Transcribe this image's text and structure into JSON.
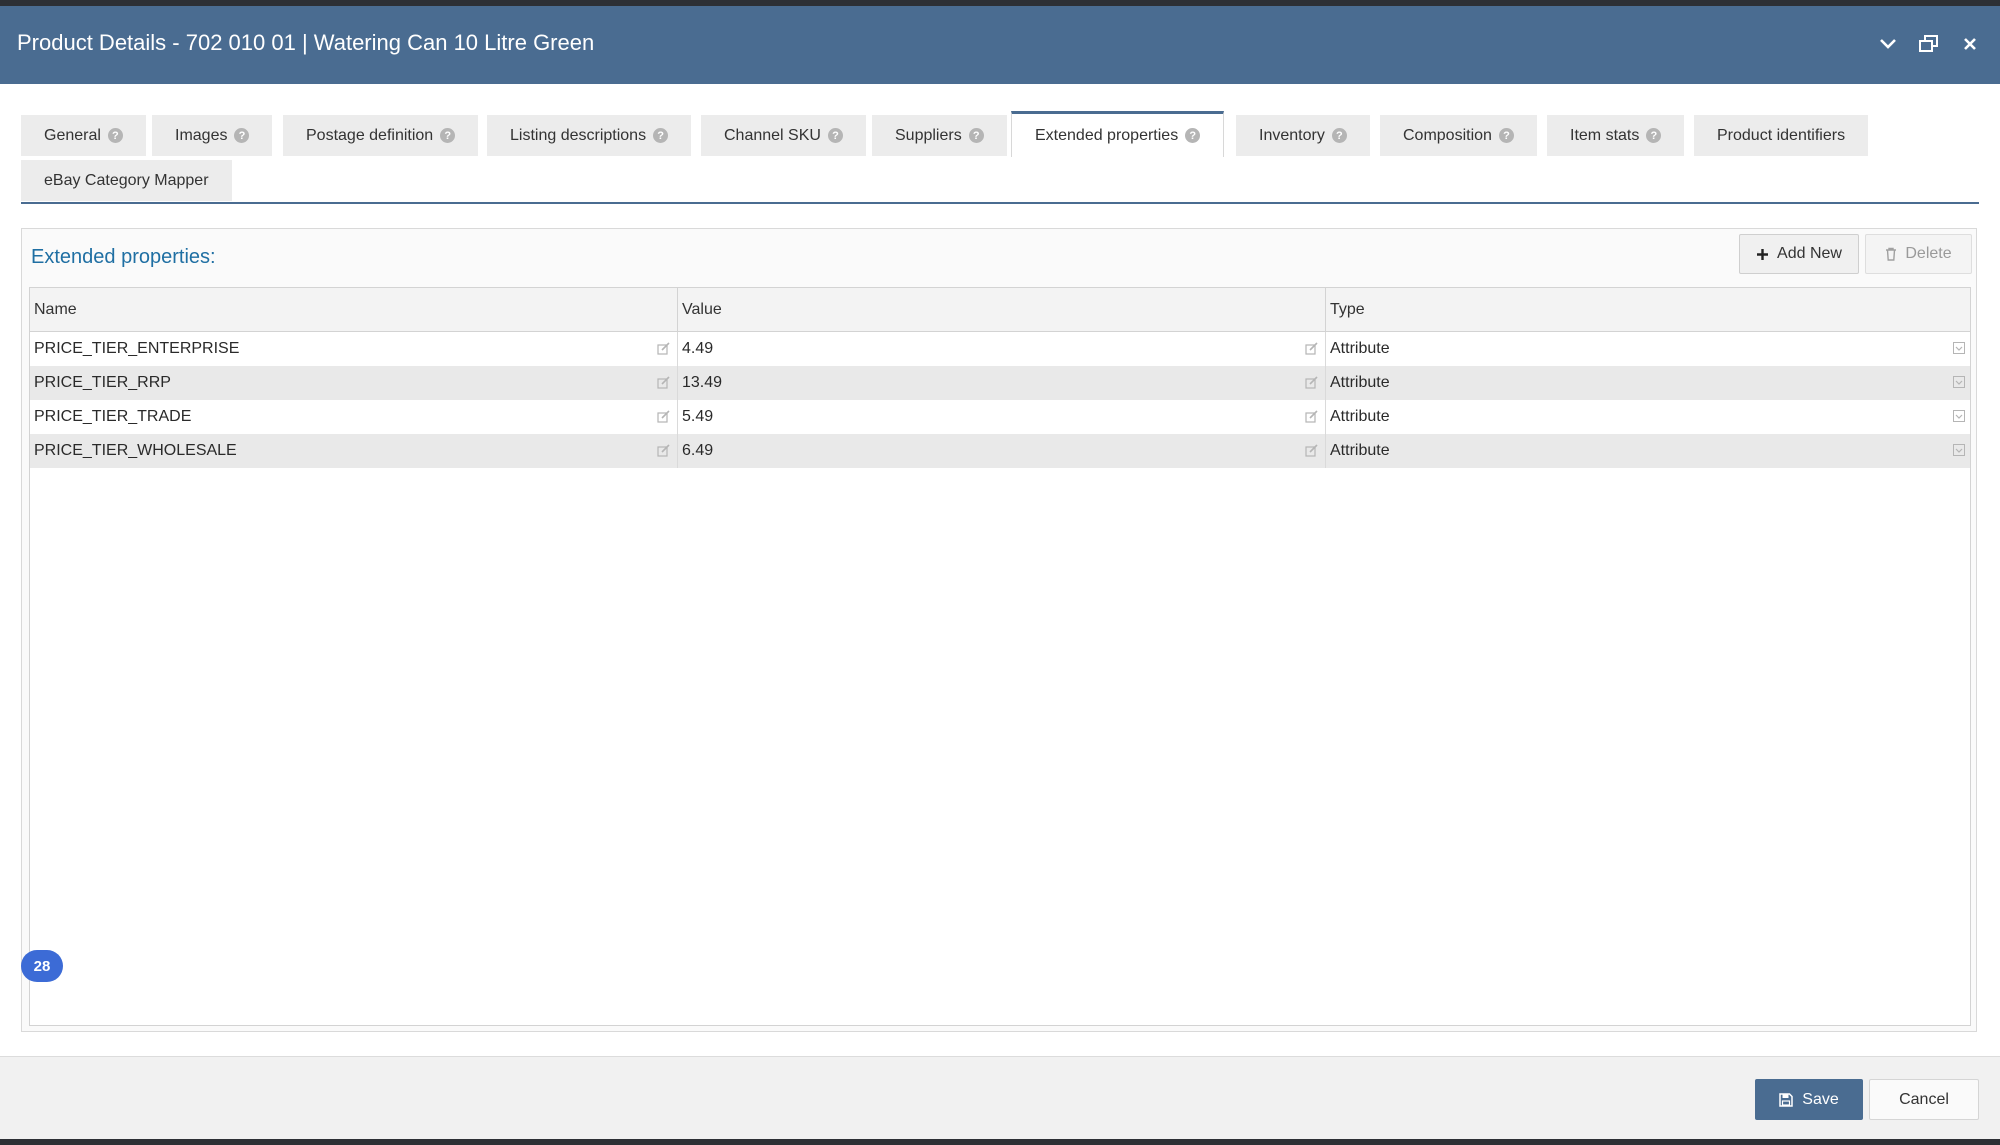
{
  "window": {
    "title": "Product Details - 702 010 01 | Watering Can 10 Litre Green"
  },
  "tabs": [
    {
      "label": "General",
      "help": true
    },
    {
      "label": "Images",
      "help": true
    },
    {
      "label": "Postage definition",
      "help": true
    },
    {
      "label": "Listing descriptions",
      "help": true
    },
    {
      "label": "Channel SKU",
      "help": true
    },
    {
      "label": "Suppliers",
      "help": true
    },
    {
      "label": "Extended properties",
      "help": true,
      "active": true
    },
    {
      "label": "Inventory",
      "help": true
    },
    {
      "label": "Composition",
      "help": true
    },
    {
      "label": "Item stats",
      "help": true
    },
    {
      "label": "Product identifiers",
      "help": false
    },
    {
      "label": "eBay Category Mapper",
      "help": false
    }
  ],
  "panel": {
    "title": "Extended properties:",
    "add_label": "Add New",
    "delete_label": "Delete"
  },
  "grid": {
    "columns": [
      "Name",
      "Value",
      "Type"
    ],
    "rows": [
      {
        "name": "PRICE_TIER_ENTERPRISE",
        "value": "4.49",
        "type": "Attribute"
      },
      {
        "name": "PRICE_TIER_RRP",
        "value": "13.49",
        "type": "Attribute"
      },
      {
        "name": "PRICE_TIER_TRADE",
        "value": "5.49",
        "type": "Attribute"
      },
      {
        "name": "PRICE_TIER_WHOLESALE",
        "value": "6.49",
        "type": "Attribute"
      }
    ]
  },
  "badge": {
    "count": "28"
  },
  "footer": {
    "save_label": "Save",
    "cancel_label": "Cancel"
  },
  "colors": {
    "header": "#4a6c91",
    "panel_title": "#1f6fa3",
    "badge": "#3c6bd6"
  }
}
